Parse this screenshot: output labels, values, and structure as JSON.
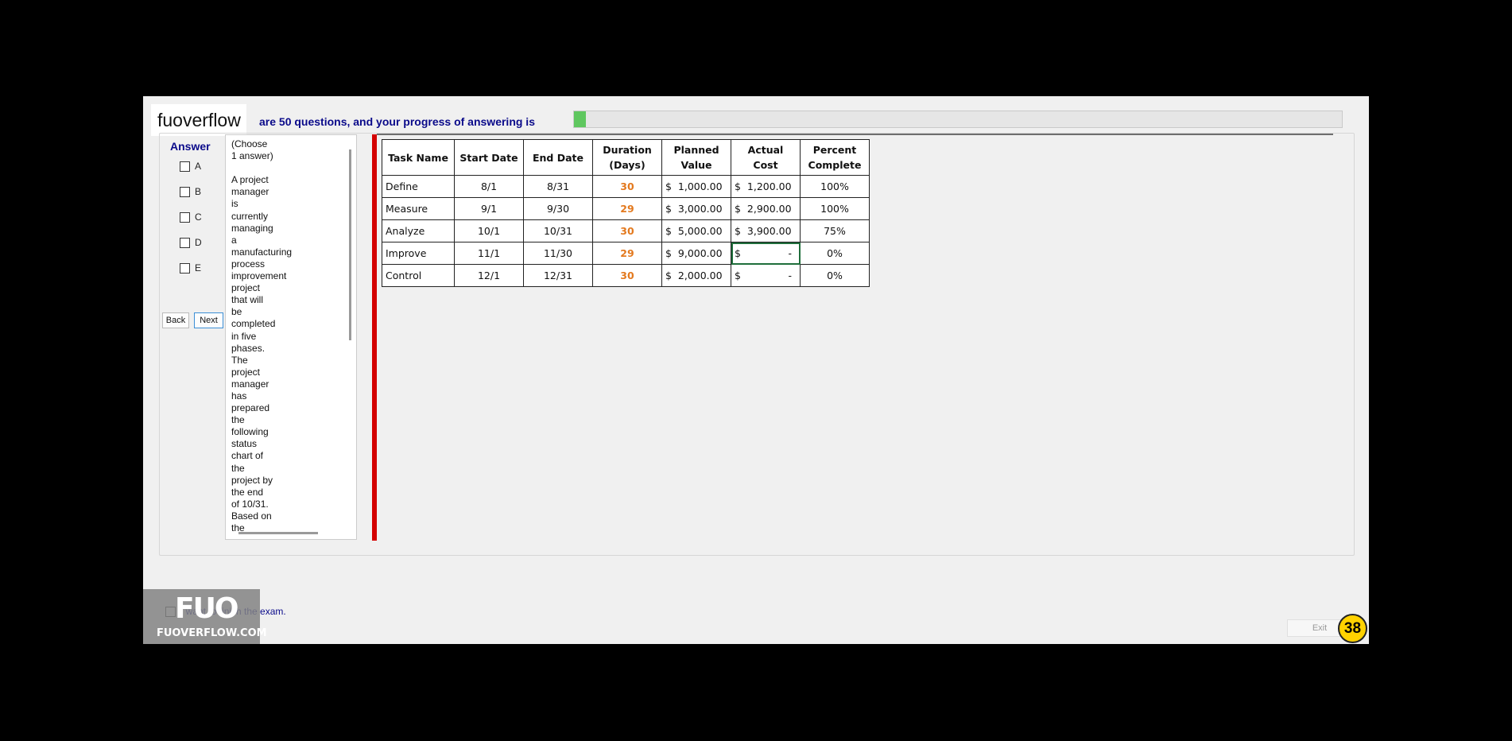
{
  "brand": "fuoverflow",
  "progress": {
    "label": "are 50 questions, and your progress of answering is",
    "fraction": 0.016
  },
  "answer": {
    "title": "Answer",
    "options": [
      "A",
      "B",
      "C",
      "D",
      "E"
    ],
    "back": "Back",
    "next": "Next"
  },
  "question": {
    "text": "(Choose\n1 answer)\n\nA project\nmanager\nis\ncurrently\nmanaging\na\nmanufacturing\nprocess\nimprovement\nproject\nthat will\nbe\ncompleted\nin five\nphases.\nThe\nproject\nmanager\nhas\nprepared\nthe\nfollowing\nstatus\nchart of\nthe\nproject by\nthe end\nof 10/31.\nBased on\nthe"
  },
  "table": {
    "headers": [
      "Task Name",
      "Start Date",
      "End Date",
      "Duration (Days)",
      "Planned Value",
      "Actual Cost",
      "Percent Complete"
    ],
    "rows": [
      [
        "Define",
        "8/1",
        "8/31",
        "30",
        "$  1,000.00",
        "$  1,200.00",
        "100%"
      ],
      [
        "Measure",
        "9/1",
        "9/30",
        "29",
        "$  3,000.00",
        "$  2,900.00",
        "100%"
      ],
      [
        "Analyze",
        "10/1",
        "10/31",
        "30",
        "$  5,000.00",
        "$  3,900.00",
        "75%"
      ],
      [
        "Improve",
        "11/1",
        "11/30",
        "29",
        "$  9,000.00",
        "$               -",
        "0%"
      ],
      [
        "Control",
        "12/1",
        "12/31",
        "30",
        "$  2,000.00",
        "$               -",
        "0%"
      ]
    ]
  },
  "finish": "I want to finish the exam.",
  "watermark": {
    "logo": "FUO",
    "site": "FUOVERFLOW.COM"
  },
  "exit": "Exit",
  "badge": "38",
  "colors": {
    "accent": "#0a0a8a",
    "progress": "#5fc75f",
    "divider": "#d40000",
    "duration": "#e3791e",
    "badge": "#ffd200"
  }
}
